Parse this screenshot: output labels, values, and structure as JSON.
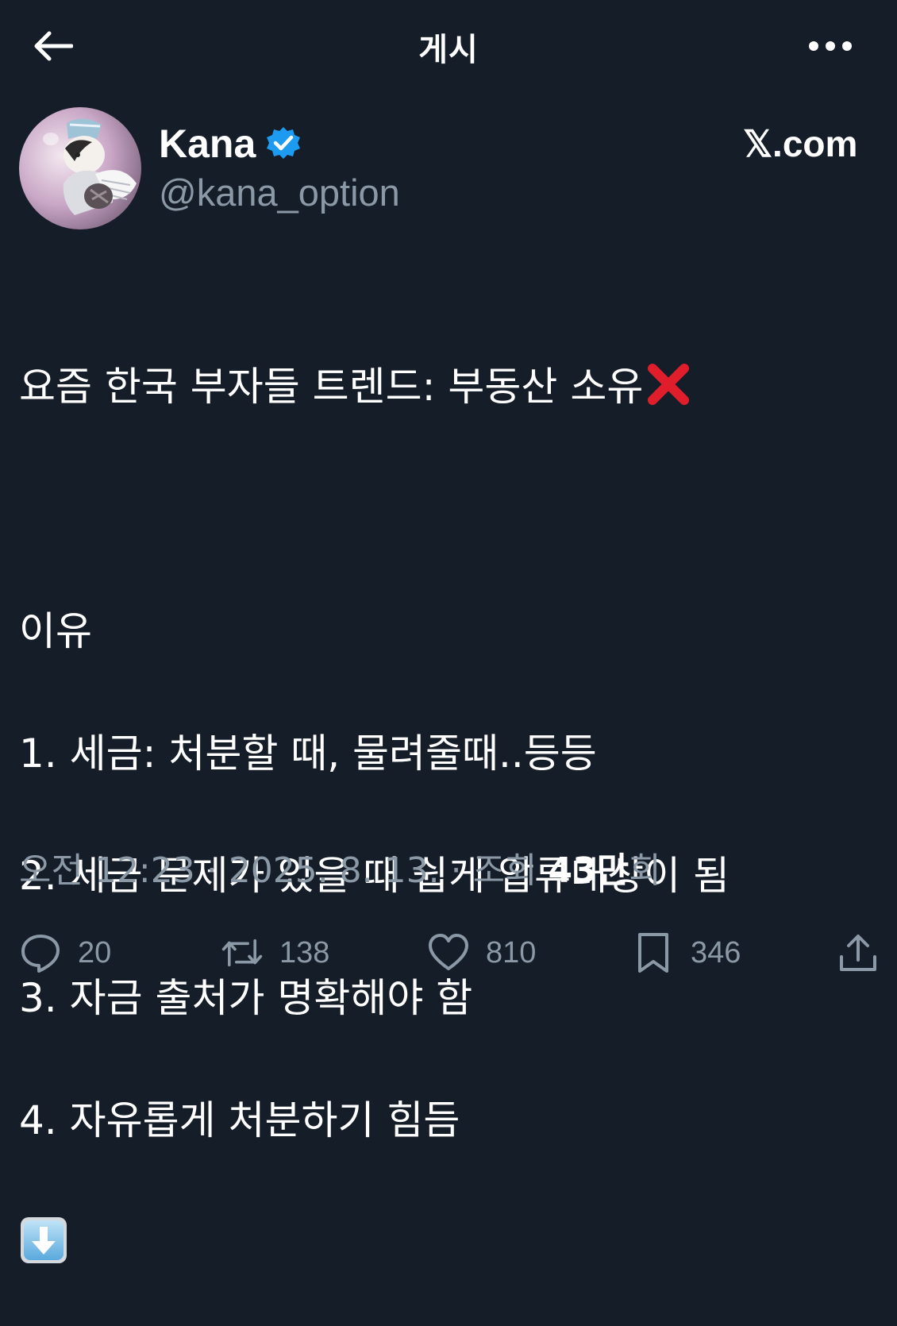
{
  "header": {
    "title": "게시",
    "back_icon": "arrow-left-icon",
    "more_icon": "more-horizontal-icon"
  },
  "author": {
    "display_name": "Kana",
    "handle": "@kana_option",
    "verified": true,
    "verified_color": "#1d9bf0",
    "avatar_icon": "avatar-cat-illustration"
  },
  "source_brand": "𝕏.com",
  "post": {
    "lines": [
      "요즘 한국 부자들 트렌드: 부동산 소유",
      "",
      "이유",
      "1. 세금: 처분할 때, 물려줄때..등등",
      "2. 세금 문제가 있을 때 쉽게 압류대상이 됨",
      "3. 자금 출처가 명확해야 함",
      "4. 자유롭게 처분하기 힘듬"
    ],
    "emojis": [
      "red-cross-mark-icon",
      "down-arrow-emoji-icon"
    ]
  },
  "meta": {
    "time": "오전 12:23",
    "separator": " · ",
    "date": "2025. 8. 13.",
    "views_label": "조회",
    "views_count": "43만",
    "views_suffix": "회"
  },
  "actions": {
    "replies": "20",
    "reposts": "138",
    "likes": "810",
    "bookmarks": "346"
  },
  "colors": {
    "background": "#151d28",
    "text": "#ffffff",
    "muted": "#8b98a5",
    "accent": "#1d9bf0"
  }
}
